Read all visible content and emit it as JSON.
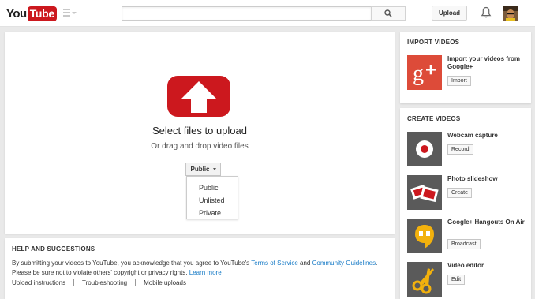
{
  "header": {
    "logo_you": "You",
    "logo_tube": "Tube",
    "search_placeholder": "",
    "upload_label": "Upload"
  },
  "upload": {
    "title": "Select files to upload",
    "subtitle": "Or drag and drop video files",
    "privacy_selected": "Public",
    "privacy_options": [
      "Public",
      "Unlisted",
      "Private"
    ]
  },
  "help": {
    "title": "HELP AND SUGGESTIONS",
    "text_1": "By submitting your videos to YouTube, you acknowledge that you agree to YouTube's ",
    "terms": "Terms of Service",
    "and": " and ",
    "guidelines": "Community Guidelines",
    "text_2": ".",
    "text_3": "Please be sure not to violate others' copyright or privacy rights. ",
    "learn_more": "Learn more",
    "links": [
      "Upload instructions",
      "Troubleshooting",
      "Mobile uploads"
    ]
  },
  "import": {
    "title": "IMPORT VIDEOS",
    "item_title": "Import your videos from Google+",
    "item_button": "Import"
  },
  "create": {
    "title": "CREATE VIDEOS",
    "items": [
      {
        "title": "Webcam capture",
        "button": "Record",
        "icon": "webcam-icon"
      },
      {
        "title": "Photo slideshow",
        "button": "Create",
        "icon": "slideshow-icon"
      },
      {
        "title": "Google+ Hangouts On Air",
        "button": "Broadcast",
        "icon": "hangouts-icon"
      },
      {
        "title": "Video editor",
        "button": "Edit",
        "icon": "scissors-icon"
      }
    ]
  },
  "colors": {
    "brand_red": "#cc181e",
    "link_blue": "#167ac6",
    "google_plus_red": "#dd4b39",
    "hangouts_yellow": "#f2b10d"
  }
}
